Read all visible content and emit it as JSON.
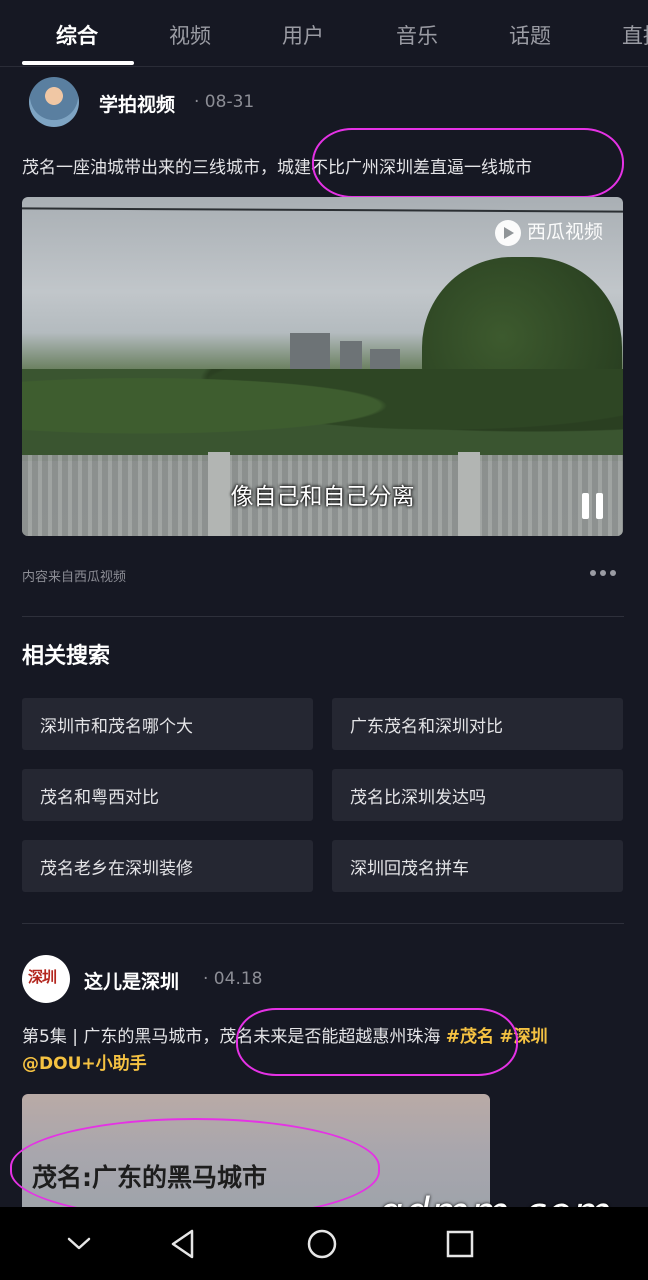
{
  "tabs": [
    {
      "label": "综合",
      "active": true
    },
    {
      "label": "视频",
      "active": false
    },
    {
      "label": "用户",
      "active": false
    },
    {
      "label": "音乐",
      "active": false
    },
    {
      "label": "话题",
      "active": false
    },
    {
      "label": "直播",
      "active": false
    }
  ],
  "post1": {
    "author": "学拍视频",
    "date": "· 08-31",
    "text_part1": "茂名一座油城带出来的三线城市，",
    "text_part2": "城建不比广州深圳差直逼一线城市",
    "video_watermark": "西瓜视频",
    "video_subtitle": "像自己和自己分离",
    "source": "内容来自西瓜视频"
  },
  "related": {
    "title": "相关搜索",
    "items": [
      "深圳市和茂名哪个大",
      "广东茂名和深圳对比",
      "茂名和粤西对比",
      "茂名比深圳发达吗",
      "茂名老乡在深圳装修",
      "深圳回茂名拼车"
    ]
  },
  "post2": {
    "author": "这儿是深圳",
    "date": "· 04.18",
    "avatar_text": "深圳",
    "text_part1": "第5集 | 广东的黑马城市，",
    "text_part2": "茂名未来是否能超越惠州珠海",
    "tag1": "#茂名",
    "tag2": "#深圳",
    "mention": "@DOU+小助手",
    "thumb_title": "茂名:广东的黑马城市"
  },
  "watermark": "gdmm.com",
  "colors": {
    "background": "#161823",
    "tag": "#f5c242",
    "annotation": "#e532e5"
  },
  "navbar": [
    "chevron-down-icon",
    "back-triangle-icon",
    "home-circle-icon",
    "recents-square-icon"
  ]
}
